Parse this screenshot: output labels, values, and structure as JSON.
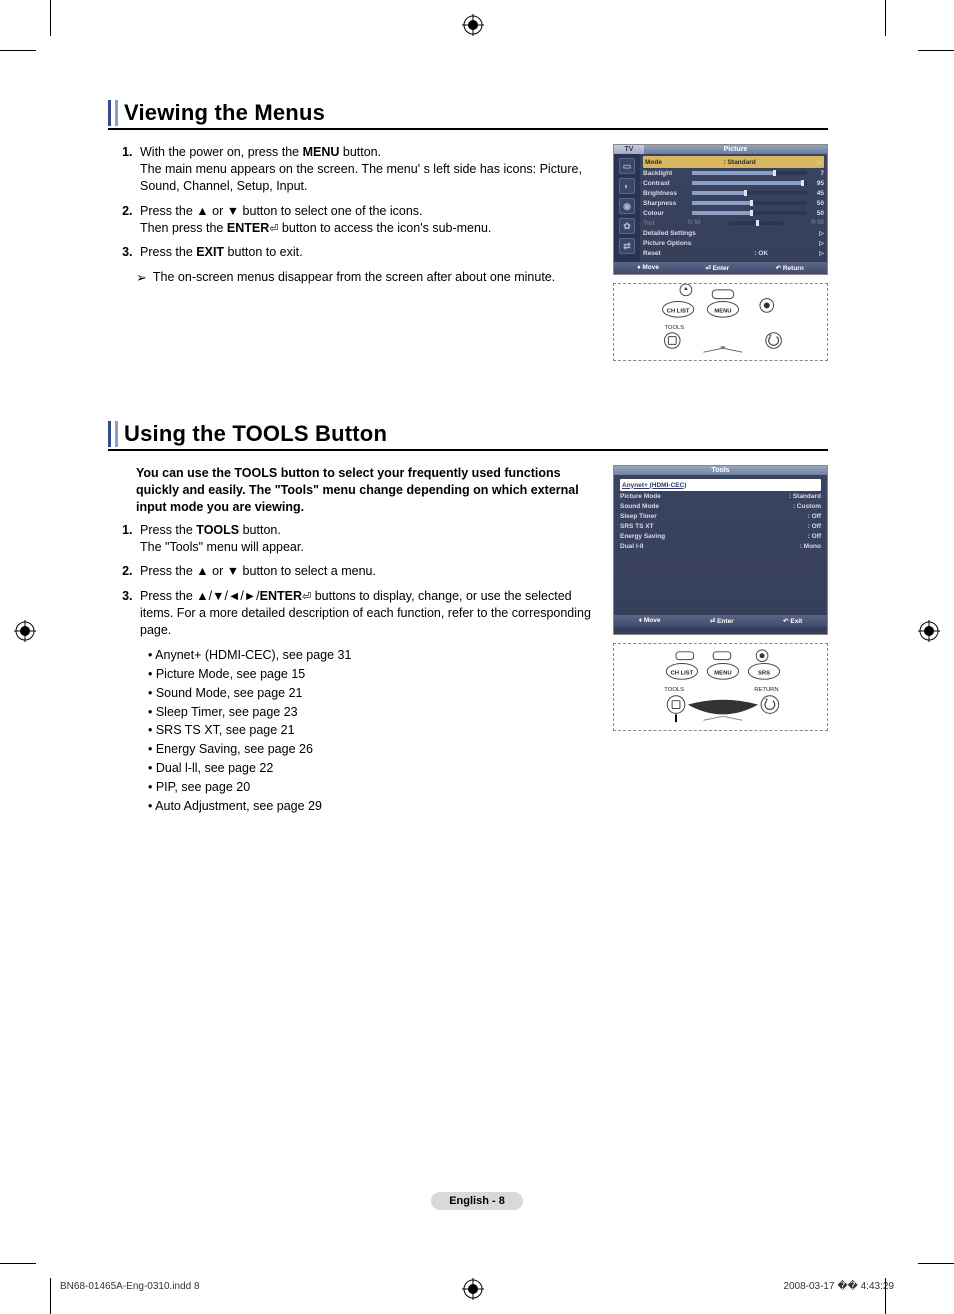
{
  "section1": {
    "title": "Viewing the Menus",
    "step1a": "With the power on, press the ",
    "step1b_bold": "MENU",
    "step1c": " button.",
    "step1_line2": "The main menu appears on the screen. The menu' s left side has icons: Picture, Sound, Channel, Setup, Input.",
    "step2a": "Press the ▲ or ▼ button to select one of the icons.",
    "step2b_pre": "Then press the ",
    "step2b_bold": "ENTER",
    "step2b_post": " button to access the icon's sub-menu.",
    "step3_pre": "Press the ",
    "step3_bold": "EXIT",
    "step3_post": " button to exit.",
    "note": "The on-screen menus disappear from the screen after about one minute."
  },
  "osd1": {
    "left_header": "TV",
    "right_header": "Picture",
    "rows": {
      "mode": {
        "label": "Mode",
        "value": ":  Standard"
      },
      "backlight": {
        "label": "Backlight",
        "value": "7"
      },
      "contrast": {
        "label": "Contrast",
        "value": "95"
      },
      "brightness": {
        "label": "Brightness",
        "value": "45"
      },
      "sharpness": {
        "label": "Sharpness",
        "value": "50"
      },
      "colour": {
        "label": "Colour",
        "value": "50"
      },
      "tint_label": "Tint",
      "tint_g": "G  50",
      "tint_r": "R  50",
      "detailed": "Detailed Settings",
      "options": "Picture Options",
      "reset": {
        "label": "Reset",
        "value": ": OK"
      }
    },
    "foot_move": "Move",
    "foot_enter": "Enter",
    "foot_return": "Return"
  },
  "section2": {
    "title": "Using the TOOLS Button",
    "intro": "You can use the TOOLS button to select your frequently used functions quickly and easily. The \"Tools\" menu change depending on which external input mode you are viewing.",
    "step1_pre": "Press the ",
    "step1_bold": "TOOLS",
    "step1_post": " button.",
    "step1_line2": "The \"Tools\" menu will appear.",
    "step2": "Press the ▲ or ▼ button to select a menu.",
    "step3_pre": "Press the ▲/▼/◄/►/",
    "step3_bold": "ENTER",
    "step3_post": " buttons to display, change, or use the selected items. For a more detailed description of each function, refer to the corresponding page.",
    "bullets": {
      "b1": "• Anynet+ (HDMI-CEC), see page 31",
      "b2": "• Picture Mode, see page 15",
      "b3": "• Sound Mode, see page 21",
      "b4": "• Sleep Timer, see page 23",
      "b5": "• SRS TS XT, see page 21",
      "b6": "• Energy Saving, see page 26",
      "b7": "• Dual l-ll, see page 22",
      "b8": "• PIP, see page 20",
      "b9": "• Auto Adjustment, see page 29"
    }
  },
  "osd2": {
    "header": "Tools",
    "hi": "Anynet+ (HDMI-CEC)",
    "rows": {
      "picture": {
        "label": "Picture Mode",
        "value": ": Standard"
      },
      "sound": {
        "label": "Sound Mode",
        "value": ": Custom"
      },
      "sleep": {
        "label": "Sleep Timer",
        "value": ": Off"
      },
      "srs": {
        "label": "SRS TS XT",
        "value": ": Off"
      },
      "energy": {
        "label": "Energy Saving",
        "value": ": Off"
      },
      "dual": {
        "label": "Dual I-II",
        "value": ": Mono"
      }
    },
    "foot_move": "Move",
    "foot_enter": "Enter",
    "foot_exit": "Exit"
  },
  "remote_labels": {
    "chlist": "CH LIST",
    "menu": "MENU",
    "tools": "TOOLS",
    "srs": "SRS",
    "return": "RETURN"
  },
  "footer": {
    "page": "English - 8",
    "print_left": "BN68-01465A-Eng-0310.indd   8",
    "print_right": "2008-03-17   �� 4:43:29"
  }
}
